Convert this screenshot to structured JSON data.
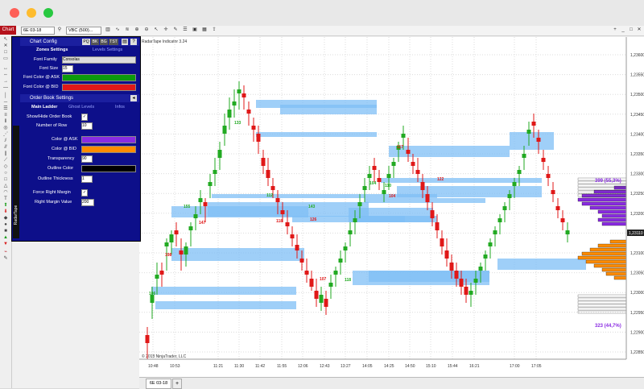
{
  "window": {
    "colors": {
      "close": "#fe5f57",
      "min": "#febc2e",
      "max": "#28c840"
    }
  },
  "toolbar": {
    "chart_tab": "Chart",
    "instrument": "6E 03-18",
    "period": "VBC (500)...",
    "labels_right": [
      "+",
      "_",
      "□",
      "✕"
    ]
  },
  "panel": {
    "chart_config_title": "Chart Config",
    "tab_buttons": [
      "PQ",
      "BK",
      "BG",
      "TST"
    ],
    "zones_tab": "Zones Settings",
    "levels_tab": "Levels Settings",
    "font_family_label": "Font Family",
    "font_family_value": "Consolas",
    "font_size_label": "Font Size",
    "font_size_value": "15",
    "font_color_ask_label": "Font Color @ ASK",
    "font_color_bid_label": "Font Color @ BID",
    "order_book_title": "Order Book Settings",
    "ladder_tabs": [
      "Main Ladder",
      "Ghost Levels",
      "Infos"
    ],
    "show_hide_label": "Show/Hide Order Book",
    "number_of_row_label": "Number of Row",
    "number_of_row_value": "10",
    "color_ask_label": "Color @ ASK",
    "color_bid_label": "Color @ BID",
    "transparency_label": "Transparency",
    "transparency_value": "90",
    "outline_color_label": "Outline Color",
    "outline_thickness_label": "Outline Thickness",
    "outline_thickness_value": "1",
    "force_right_margin_label": "Force Right Margin",
    "right_margin_value_label": "Right Margin Value",
    "right_margin_value": "200",
    "side_tab_label": "RadarTape",
    "colors": {
      "ask_font": "#0c9a0c",
      "bid_font": "#e01818",
      "ask_book": "#8a2be2",
      "bid_book": "#ff8c00",
      "outline": "#000000"
    }
  },
  "chart": {
    "indicator_label": "RadarTape Indicator 3.24",
    "copyright": "© 2018 NinjaTrader, LLC",
    "price_labels": [
      "1,23600",
      "1,23550",
      "1,23500",
      "1,23450",
      "1,23400",
      "1,23350",
      "1,23300",
      "1,23250",
      "1,23200",
      "1,23150",
      "1,23100",
      "1,23050",
      "1,23000",
      "1,22950",
      "1,22900",
      "1,22850"
    ],
    "current_price": "1,23110",
    "time_labels": [
      "10:48",
      "10:53",
      "11:21",
      "11:30",
      "11:42",
      "11:55",
      "12:06",
      "12:43",
      "13:27",
      "14:05",
      "14:25",
      "14:50",
      "15:10",
      "15:44",
      "16:21",
      "17:00",
      "17:05"
    ],
    "ask_total": "399 (55,3%)",
    "bid_total": "323 (44,7%)",
    "volume_labels": [
      "106",
      "198",
      "155",
      "147",
      "112",
      "118",
      "143",
      "107",
      "104",
      "126",
      "118",
      "117",
      "110",
      "122",
      "133",
      "104"
    ],
    "colors": {
      "up": "#22aa22",
      "down": "#e01818",
      "zone": "#7fbff5",
      "grid": "#dcdcdc"
    }
  },
  "bottom": {
    "tab": "6E 03-18",
    "add": "+"
  }
}
